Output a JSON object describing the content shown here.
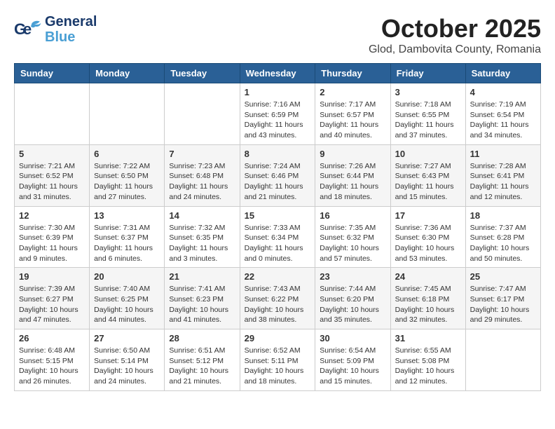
{
  "header": {
    "logo": {
      "line1": "General",
      "line2": "Blue"
    },
    "title": "October 2025",
    "location": "Glod, Dambovita County, Romania"
  },
  "weekdays": [
    "Sunday",
    "Monday",
    "Tuesday",
    "Wednesday",
    "Thursday",
    "Friday",
    "Saturday"
  ],
  "weeks": [
    [
      {
        "day": "",
        "sunrise": "",
        "sunset": "",
        "daylight": ""
      },
      {
        "day": "",
        "sunrise": "",
        "sunset": "",
        "daylight": ""
      },
      {
        "day": "",
        "sunrise": "",
        "sunset": "",
        "daylight": ""
      },
      {
        "day": "1",
        "sunrise": "Sunrise: 7:16 AM",
        "sunset": "Sunset: 6:59 PM",
        "daylight": "Daylight: 11 hours and 43 minutes."
      },
      {
        "day": "2",
        "sunrise": "Sunrise: 7:17 AM",
        "sunset": "Sunset: 6:57 PM",
        "daylight": "Daylight: 11 hours and 40 minutes."
      },
      {
        "day": "3",
        "sunrise": "Sunrise: 7:18 AM",
        "sunset": "Sunset: 6:55 PM",
        "daylight": "Daylight: 11 hours and 37 minutes."
      },
      {
        "day": "4",
        "sunrise": "Sunrise: 7:19 AM",
        "sunset": "Sunset: 6:54 PM",
        "daylight": "Daylight: 11 hours and 34 minutes."
      }
    ],
    [
      {
        "day": "5",
        "sunrise": "Sunrise: 7:21 AM",
        "sunset": "Sunset: 6:52 PM",
        "daylight": "Daylight: 11 hours and 31 minutes."
      },
      {
        "day": "6",
        "sunrise": "Sunrise: 7:22 AM",
        "sunset": "Sunset: 6:50 PM",
        "daylight": "Daylight: 11 hours and 27 minutes."
      },
      {
        "day": "7",
        "sunrise": "Sunrise: 7:23 AM",
        "sunset": "Sunset: 6:48 PM",
        "daylight": "Daylight: 11 hours and 24 minutes."
      },
      {
        "day": "8",
        "sunrise": "Sunrise: 7:24 AM",
        "sunset": "Sunset: 6:46 PM",
        "daylight": "Daylight: 11 hours and 21 minutes."
      },
      {
        "day": "9",
        "sunrise": "Sunrise: 7:26 AM",
        "sunset": "Sunset: 6:44 PM",
        "daylight": "Daylight: 11 hours and 18 minutes."
      },
      {
        "day": "10",
        "sunrise": "Sunrise: 7:27 AM",
        "sunset": "Sunset: 6:43 PM",
        "daylight": "Daylight: 11 hours and 15 minutes."
      },
      {
        "day": "11",
        "sunrise": "Sunrise: 7:28 AM",
        "sunset": "Sunset: 6:41 PM",
        "daylight": "Daylight: 11 hours and 12 minutes."
      }
    ],
    [
      {
        "day": "12",
        "sunrise": "Sunrise: 7:30 AM",
        "sunset": "Sunset: 6:39 PM",
        "daylight": "Daylight: 11 hours and 9 minutes."
      },
      {
        "day": "13",
        "sunrise": "Sunrise: 7:31 AM",
        "sunset": "Sunset: 6:37 PM",
        "daylight": "Daylight: 11 hours and 6 minutes."
      },
      {
        "day": "14",
        "sunrise": "Sunrise: 7:32 AM",
        "sunset": "Sunset: 6:35 PM",
        "daylight": "Daylight: 11 hours and 3 minutes."
      },
      {
        "day": "15",
        "sunrise": "Sunrise: 7:33 AM",
        "sunset": "Sunset: 6:34 PM",
        "daylight": "Daylight: 11 hours and 0 minutes."
      },
      {
        "day": "16",
        "sunrise": "Sunrise: 7:35 AM",
        "sunset": "Sunset: 6:32 PM",
        "daylight": "Daylight: 10 hours and 57 minutes."
      },
      {
        "day": "17",
        "sunrise": "Sunrise: 7:36 AM",
        "sunset": "Sunset: 6:30 PM",
        "daylight": "Daylight: 10 hours and 53 minutes."
      },
      {
        "day": "18",
        "sunrise": "Sunrise: 7:37 AM",
        "sunset": "Sunset: 6:28 PM",
        "daylight": "Daylight: 10 hours and 50 minutes."
      }
    ],
    [
      {
        "day": "19",
        "sunrise": "Sunrise: 7:39 AM",
        "sunset": "Sunset: 6:27 PM",
        "daylight": "Daylight: 10 hours and 47 minutes."
      },
      {
        "day": "20",
        "sunrise": "Sunrise: 7:40 AM",
        "sunset": "Sunset: 6:25 PM",
        "daylight": "Daylight: 10 hours and 44 minutes."
      },
      {
        "day": "21",
        "sunrise": "Sunrise: 7:41 AM",
        "sunset": "Sunset: 6:23 PM",
        "daylight": "Daylight: 10 hours and 41 minutes."
      },
      {
        "day": "22",
        "sunrise": "Sunrise: 7:43 AM",
        "sunset": "Sunset: 6:22 PM",
        "daylight": "Daylight: 10 hours and 38 minutes."
      },
      {
        "day": "23",
        "sunrise": "Sunrise: 7:44 AM",
        "sunset": "Sunset: 6:20 PM",
        "daylight": "Daylight: 10 hours and 35 minutes."
      },
      {
        "day": "24",
        "sunrise": "Sunrise: 7:45 AM",
        "sunset": "Sunset: 6:18 PM",
        "daylight": "Daylight: 10 hours and 32 minutes."
      },
      {
        "day": "25",
        "sunrise": "Sunrise: 7:47 AM",
        "sunset": "Sunset: 6:17 PM",
        "daylight": "Daylight: 10 hours and 29 minutes."
      }
    ],
    [
      {
        "day": "26",
        "sunrise": "Sunrise: 6:48 AM",
        "sunset": "Sunset: 5:15 PM",
        "daylight": "Daylight: 10 hours and 26 minutes."
      },
      {
        "day": "27",
        "sunrise": "Sunrise: 6:50 AM",
        "sunset": "Sunset: 5:14 PM",
        "daylight": "Daylight: 10 hours and 24 minutes."
      },
      {
        "day": "28",
        "sunrise": "Sunrise: 6:51 AM",
        "sunset": "Sunset: 5:12 PM",
        "daylight": "Daylight: 10 hours and 21 minutes."
      },
      {
        "day": "29",
        "sunrise": "Sunrise: 6:52 AM",
        "sunset": "Sunset: 5:11 PM",
        "daylight": "Daylight: 10 hours and 18 minutes."
      },
      {
        "day": "30",
        "sunrise": "Sunrise: 6:54 AM",
        "sunset": "Sunset: 5:09 PM",
        "daylight": "Daylight: 10 hours and 15 minutes."
      },
      {
        "day": "31",
        "sunrise": "Sunrise: 6:55 AM",
        "sunset": "Sunset: 5:08 PM",
        "daylight": "Daylight: 10 hours and 12 minutes."
      },
      {
        "day": "",
        "sunrise": "",
        "sunset": "",
        "daylight": ""
      }
    ]
  ]
}
